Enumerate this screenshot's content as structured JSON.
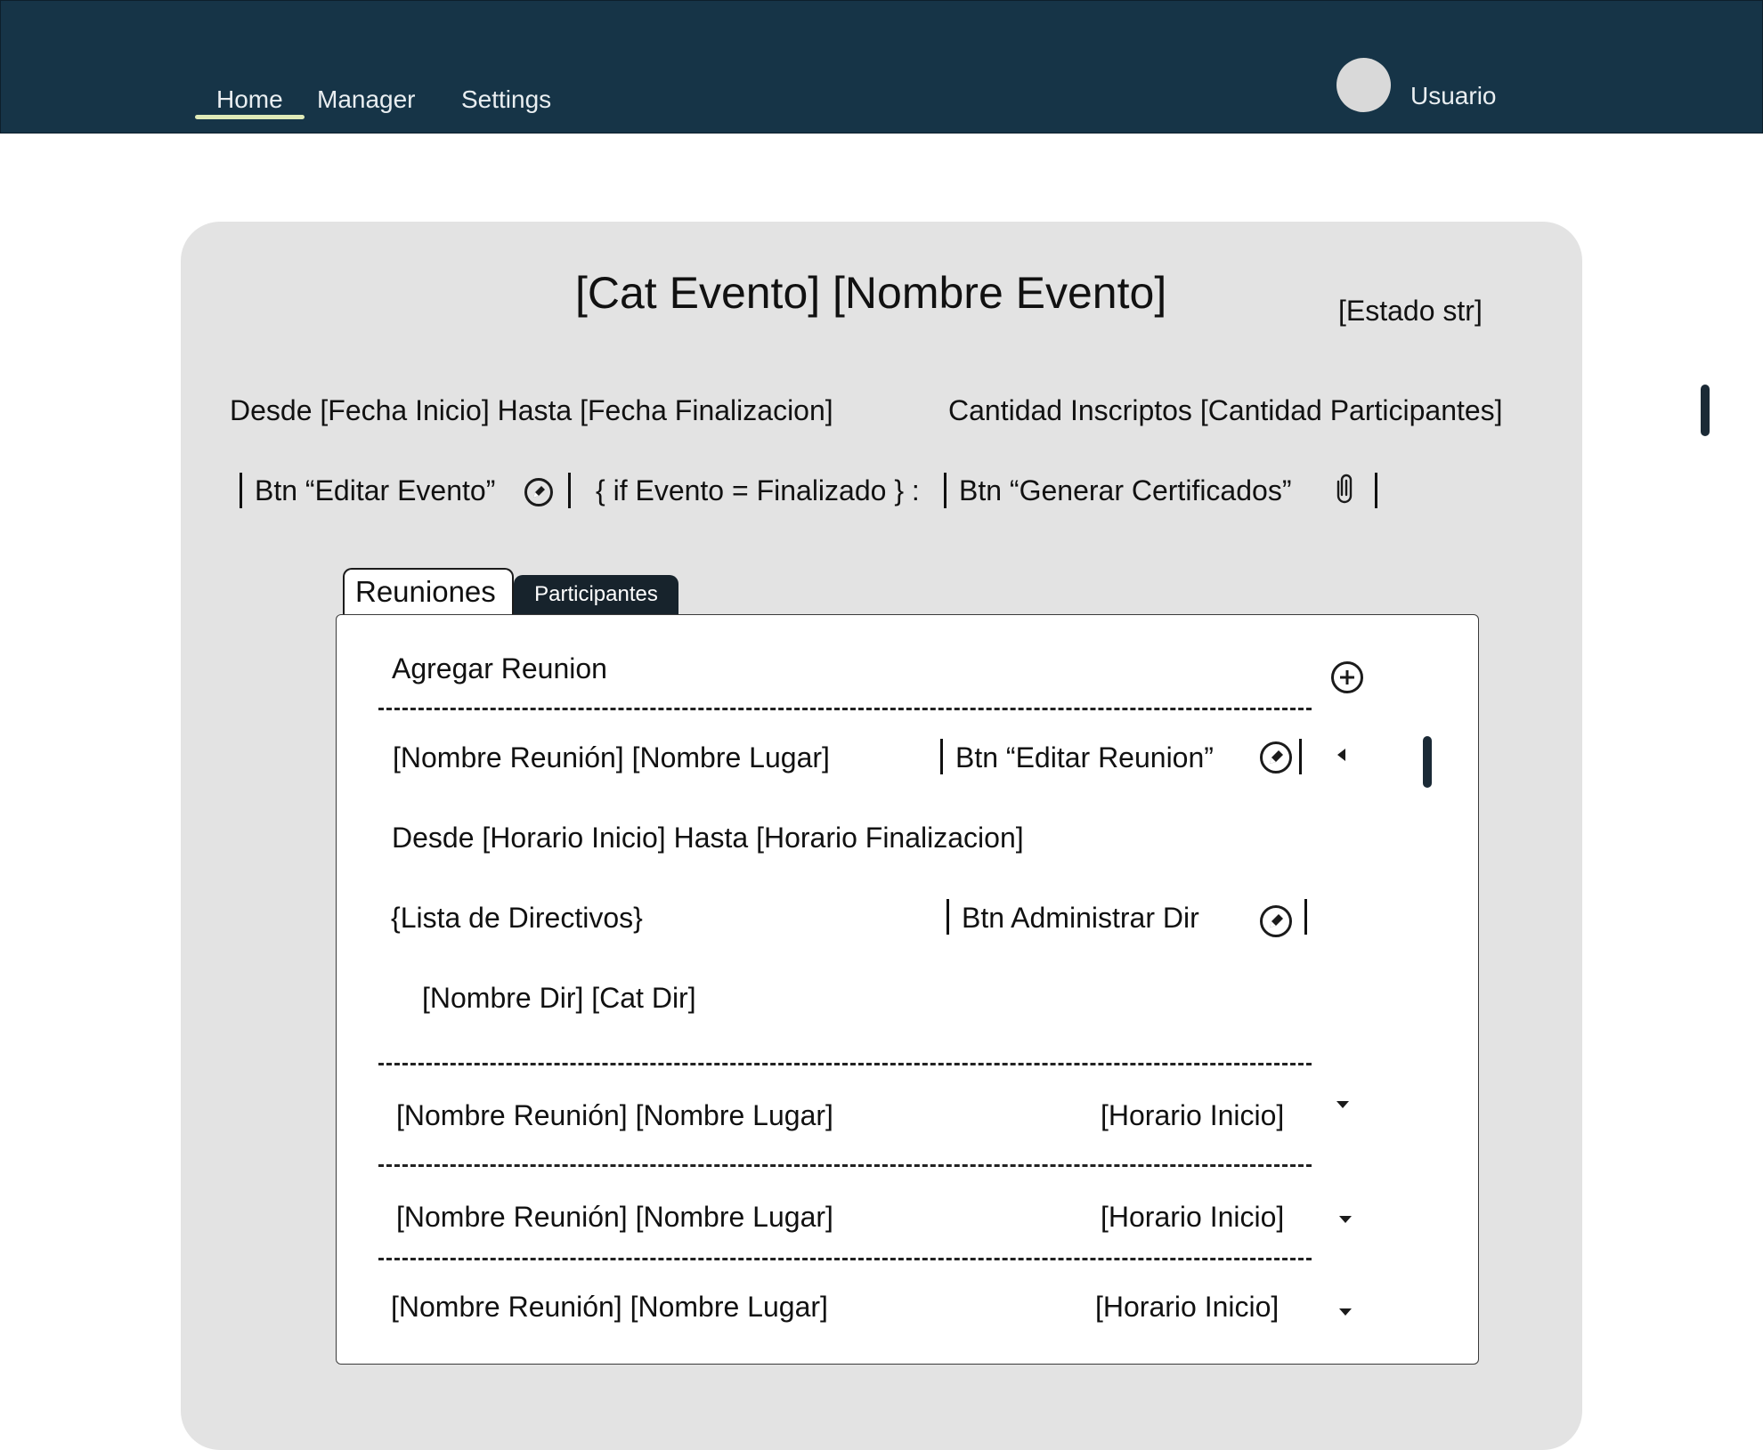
{
  "nav": {
    "home": "Home",
    "manager": "Manager",
    "settings": "Settings",
    "user": "Usuario"
  },
  "event": {
    "title": "[Cat Evento] [Nombre Evento]",
    "state": "[Estado str]",
    "dates": "Desde [Fecha Inicio]  Hasta [Fecha Finalizacion]",
    "enrolled": "Cantidad Inscriptos [Cantidad Participantes]",
    "edit_button": "Btn “Editar Evento”",
    "conditional": "{ if Evento = Finalizado } :",
    "certificates_button": "Btn “Generar Certificados”"
  },
  "tabs": {
    "meetings": "Reuniones",
    "participants": "Participantes"
  },
  "meetings": {
    "add_label": "Agregar  Reunion",
    "expanded": {
      "name_place": "[Nombre Reunión]  [Nombre Lugar]",
      "edit_button": "Btn “Editar Reunion”",
      "schedule": "Desde [Horario Inicio]  Hasta [Horario Finalizacion]",
      "directors_label": "{Lista de Directivos}",
      "admin_button": "Btn Administrar Dir",
      "director_item": "[Nombre Dir] [Cat Dir]"
    },
    "collapsed": [
      {
        "name_place": "[Nombre Reunión]  [Nombre Lugar]",
        "time": "[Horario Inicio]"
      },
      {
        "name_place": "[Nombre Reunión]  [Nombre Lugar]",
        "time": "[Horario Inicio]"
      },
      {
        "name_place": "[Nombre Reunión]  [Nombre Lugar]",
        "time": "[Horario Inicio]"
      }
    ]
  },
  "icons": {
    "edit": "pencil-circle-icon",
    "attach": "paperclip-icon",
    "add": "plus-circle-icon",
    "expand": "caret-down-icon",
    "collapse": "caret-left-icon"
  },
  "colors": {
    "topbar": "#163447",
    "nav_underline": "#dfeab8",
    "card": "#e3e3e3",
    "tab_inactive": "#17232c"
  }
}
